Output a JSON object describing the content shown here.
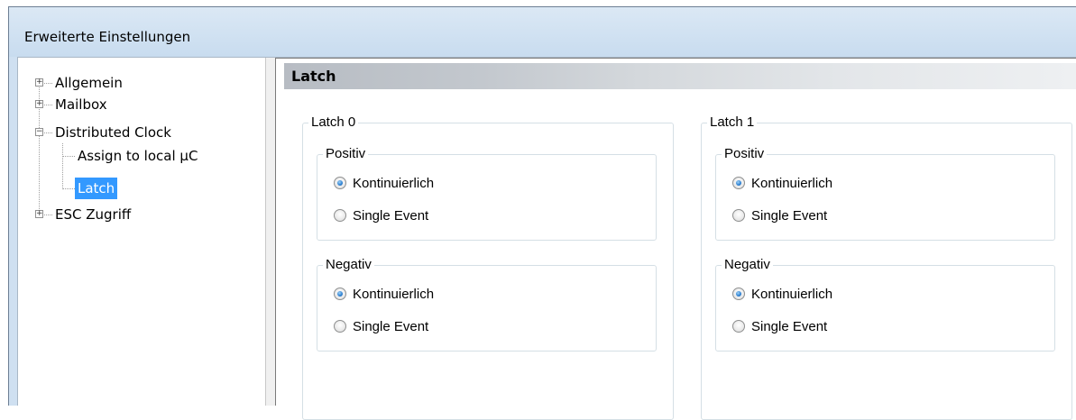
{
  "window": {
    "title": "Erweiterte Einstellungen"
  },
  "tree": {
    "items": [
      {
        "label": "Allgemein",
        "expander": "+"
      },
      {
        "label": "Mailbox",
        "expander": "+"
      },
      {
        "label": "Distributed Clock",
        "expander": "−"
      },
      {
        "label": "Assign to local µC"
      },
      {
        "label": "Latch",
        "selected": true
      },
      {
        "label": "ESC Zugriff",
        "expander": "+"
      }
    ]
  },
  "pane": {
    "title": "Latch",
    "latches": [
      {
        "title": "Latch 0",
        "groups": [
          {
            "title": "Positiv",
            "options": [
              {
                "label": "Kontinuierlich",
                "checked": true
              },
              {
                "label": "Single Event",
                "checked": false
              }
            ]
          },
          {
            "title": "Negativ",
            "options": [
              {
                "label": "Kontinuierlich",
                "checked": true
              },
              {
                "label": "Single Event",
                "checked": false
              }
            ]
          }
        ]
      },
      {
        "title": "Latch 1",
        "groups": [
          {
            "title": "Positiv",
            "options": [
              {
                "label": "Kontinuierlich",
                "checked": true
              },
              {
                "label": "Single Event",
                "checked": false
              }
            ]
          },
          {
            "title": "Negativ",
            "options": [
              {
                "label": "Kontinuierlich",
                "checked": true
              },
              {
                "label": "Single Event",
                "checked": false
              }
            ]
          }
        ]
      }
    ]
  }
}
